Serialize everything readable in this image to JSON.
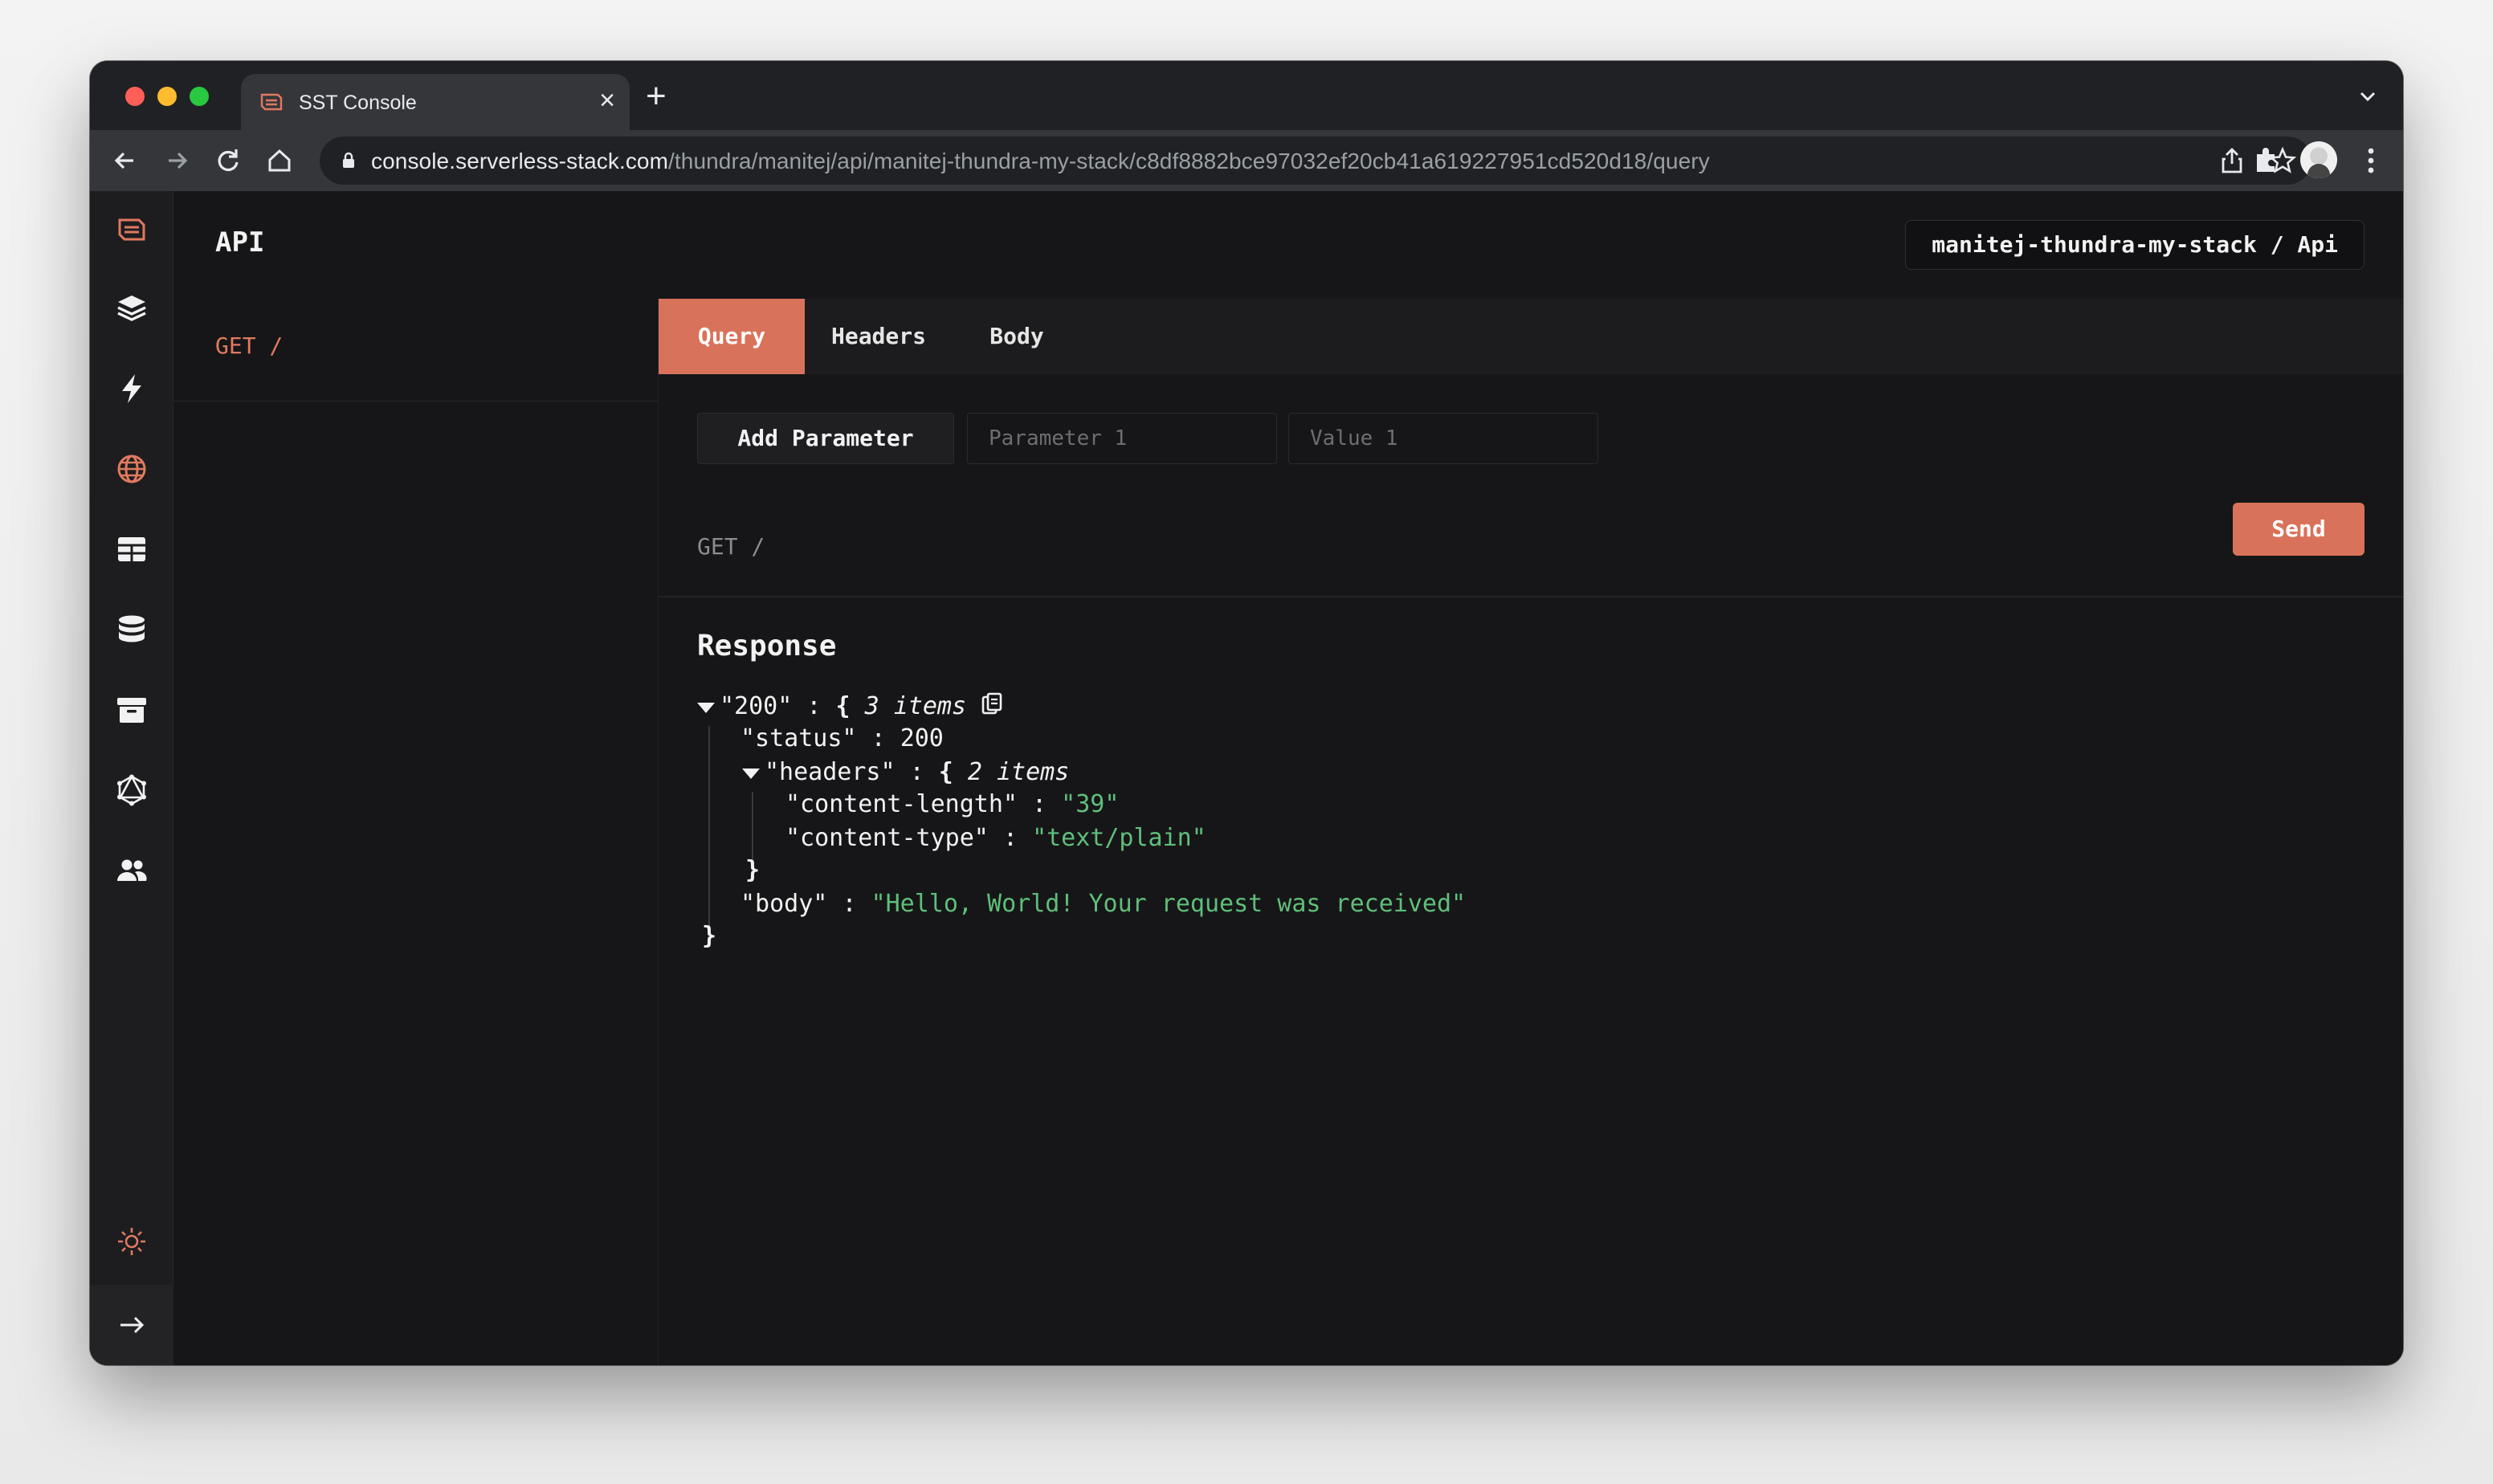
{
  "browser": {
    "tab_title": "SST Console",
    "tab_close": "×",
    "new_tab": "+",
    "url_host": "console.serverless-stack.com",
    "url_path": "/thundra/manitej/api/manitej-thundra-my-stack/c8df8882bce97032ef20cb41a619227951cd520d18/query"
  },
  "colors": {
    "accent": "#d9725a",
    "string_value": "#5fbf7a",
    "background": "#161618"
  },
  "sidebar": {
    "icons": [
      "sst-logo-icon",
      "stacks-layers-icon",
      "functions-bolt-icon",
      "api-globe-icon",
      "dynamodb-table-icon",
      "rds-database-icon",
      "buckets-archive-icon",
      "graphql-icon",
      "cognito-users-icon",
      "theme-sun-icon",
      "expand-arrow-icon"
    ]
  },
  "header": {
    "title": "API",
    "stack_badge": "manitej-thundra-my-stack / Api"
  },
  "routes": [
    {
      "label": "GET /"
    }
  ],
  "tabs": [
    {
      "label": "Query",
      "active": true
    },
    {
      "label": "Headers",
      "active": false
    },
    {
      "label": "Body",
      "active": false
    }
  ],
  "query": {
    "add_parameter_label": "Add Parameter",
    "parameter_placeholder": "Parameter 1",
    "value_placeholder": "Value 1",
    "request_line": "GET /",
    "send_label": "Send"
  },
  "response": {
    "title": "Response",
    "root_key": "\"200\"",
    "root_open": "{",
    "root_count": "3 items",
    "status_key": "\"status\"",
    "status_value": "200",
    "headers_key": "\"headers\"",
    "headers_open": "{",
    "headers_count": "2 items",
    "content_length_key": "\"content-length\"",
    "content_length_value": "\"39\"",
    "content_type_key": "\"content-type\"",
    "content_type_value": "\"text/plain\"",
    "headers_close": "}",
    "body_key": "\"body\"",
    "body_value": "\"Hello, World! Your request was received\"",
    "root_close": "}",
    "separator": ":"
  }
}
